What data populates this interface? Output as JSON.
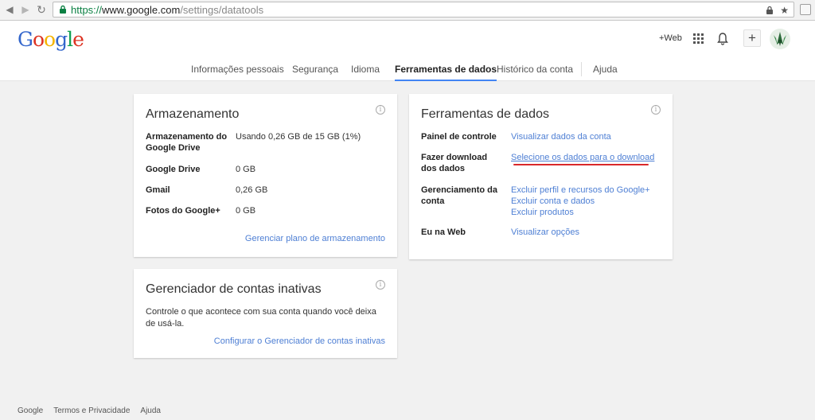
{
  "browser": {
    "url_scheme": "https://",
    "url_host": "www.google.com",
    "url_path": "/settings/datatools"
  },
  "header": {
    "logo_text": "Google",
    "plus_web": "+Web",
    "plus_label": "+"
  },
  "tabs": [
    {
      "label": "Informações pessoais",
      "active": false
    },
    {
      "label": "Segurança",
      "active": false
    },
    {
      "label": "Idioma",
      "active": false
    },
    {
      "label": "Ferramentas de dados",
      "active": true
    },
    {
      "label": "Histórico da conta",
      "active": false
    },
    {
      "label": "Ajuda",
      "active": false
    }
  ],
  "storage": {
    "title": "Armazenamento",
    "rows": [
      {
        "label": "Armazenamento do Google Drive",
        "value": "Usando 0,26 GB de 15 GB (1%)"
      },
      {
        "label": "Google Drive",
        "value": "0 GB"
      },
      {
        "label": "Gmail",
        "value": "0,26 GB"
      },
      {
        "label": "Fotos do Google+",
        "value": "0 GB"
      }
    ],
    "manage_link": "Gerenciar plano de armazenamento"
  },
  "inactive": {
    "title": "Gerenciador de contas inativas",
    "description": "Controle o que acontece com sua conta quando você deixa de usá-la.",
    "config_link": "Configurar o Gerenciador de contas inativas"
  },
  "datatools": {
    "title": "Ferramentas de dados",
    "dashboard_label": "Painel de controle",
    "dashboard_link": "Visualizar dados da conta",
    "download_label": "Fazer download dos dados",
    "download_link": "Selecione os dados para o download",
    "account_label": "Gerenciamento da conta",
    "account_links": [
      "Excluir perfil e recursos do Google+",
      "Excluir conta e dados",
      "Excluir produtos"
    ],
    "web_label": "Eu na Web",
    "web_link": "Visualizar opções"
  },
  "footer": [
    "Google",
    "Termos e Privacidade",
    "Ajuda"
  ],
  "colors": {
    "link": "#4e7fd4",
    "active_tab": "#4285f4",
    "annotation": "#d9282a"
  }
}
